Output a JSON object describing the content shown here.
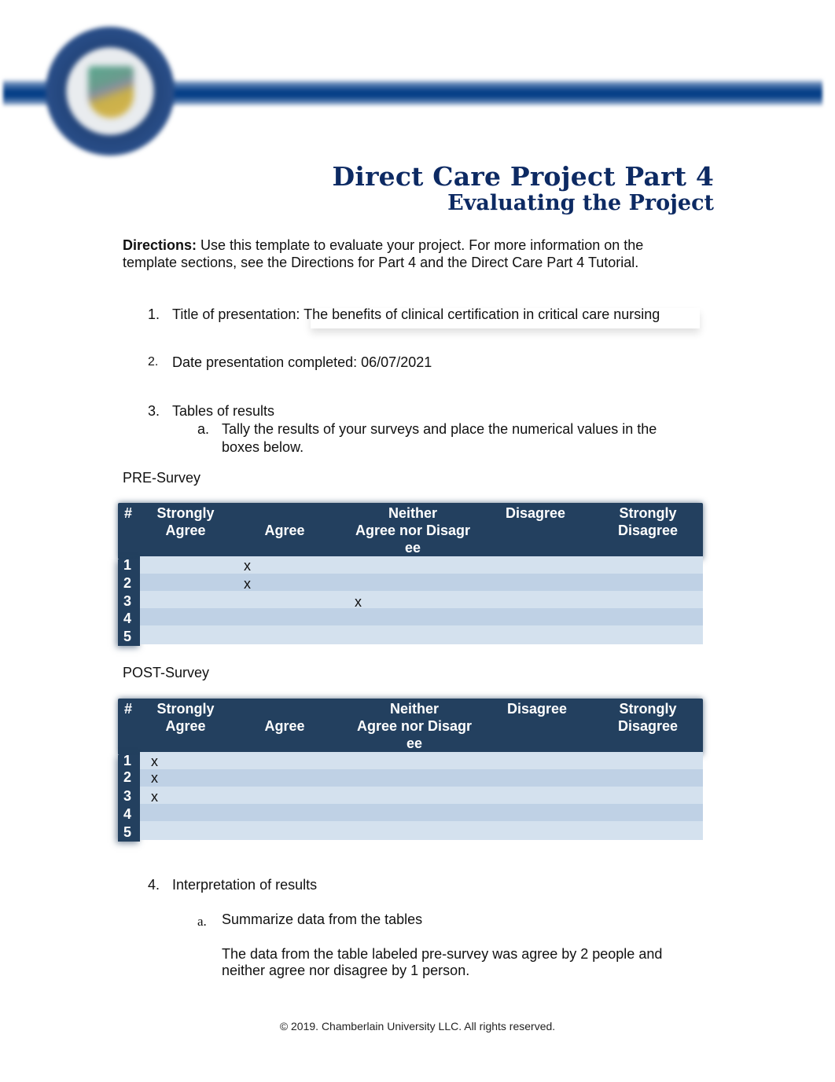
{
  "header": {
    "logo": "university-seal",
    "title": "Direct Care Project Part 4",
    "subtitle": "Evaluating the Project"
  },
  "directions": {
    "label": "Directions:",
    "line1": " Use this template to evaluate your project. For more information on the",
    "line2": "template sections, see the Directions for Part 4 and the Direct Care Part 4 Tutorial."
  },
  "items": {
    "item1": {
      "number": "1.",
      "text": "Title of presentation: The benefits of clinical certification in critical care nursing"
    },
    "item2": {
      "number": "2.",
      "text": "Date presentation completed: 06/07/2021"
    },
    "item3": {
      "number": "3.",
      "text": "Tables of results",
      "sub_a": {
        "letter": "a.",
        "line1": "Tally the results of your surveys and place the numerical values in the",
        "line2": "boxes below."
      }
    },
    "item4": {
      "number": "4.",
      "text": "Interpretation of results",
      "sub_a": {
        "letter": "a.",
        "text": "Summarize data from the tables",
        "answer_line1": "The data from the table labeled pre-survey was agree by 2 people and",
        "answer_line2": "neither agree nor disagree by 1 person."
      }
    }
  },
  "tables": {
    "columns": {
      "num": "#",
      "strongly_agree_1": "Strongly",
      "strongly_agree_2": "Agree",
      "agree": "Agree",
      "neither_1": "Neither",
      "neither_2": "Agree nor Disagr",
      "neither_3": "ee",
      "disagree": "Disagree",
      "strongly_disagree_1": "Strongly",
      "strongly_disagree_2": "Disagree"
    },
    "pre": {
      "label": "PRE-Survey",
      "rows": [
        {
          "n": "1",
          "strongly_agree": "",
          "agree": "x",
          "neither": "",
          "disagree": "",
          "strongly_disagree": ""
        },
        {
          "n": "2",
          "strongly_agree": "",
          "agree": "x",
          "neither": "",
          "disagree": "",
          "strongly_disagree": ""
        },
        {
          "n": "3",
          "strongly_agree": "",
          "agree": "",
          "neither": "x",
          "disagree": "",
          "strongly_disagree": ""
        },
        {
          "n": "4",
          "strongly_agree": "",
          "agree": "",
          "neither": "",
          "disagree": "",
          "strongly_disagree": ""
        },
        {
          "n": "5",
          "strongly_agree": "",
          "agree": "",
          "neither": "",
          "disagree": "",
          "strongly_disagree": ""
        }
      ]
    },
    "post": {
      "label": "POST-Survey",
      "rows": [
        {
          "n": "1",
          "strongly_agree": "x",
          "agree": "",
          "neither": "",
          "disagree": "",
          "strongly_disagree": ""
        },
        {
          "n": "2",
          "strongly_agree": "x",
          "agree": "",
          "neither": "",
          "disagree": "",
          "strongly_disagree": ""
        },
        {
          "n": "3",
          "strongly_agree": "x",
          "agree": "",
          "neither": "",
          "disagree": "",
          "strongly_disagree": ""
        },
        {
          "n": "4",
          "strongly_agree": "",
          "agree": "",
          "neither": "",
          "disagree": "",
          "strongly_disagree": ""
        },
        {
          "n": "5",
          "strongly_agree": "",
          "agree": "",
          "neither": "",
          "disagree": "",
          "strongly_disagree": ""
        }
      ]
    }
  },
  "footer": {
    "copyright": "© 2019. Chamberlain University LLC. All rights reserved."
  },
  "colors": {
    "brand_navy": "#0d2a63",
    "banner_blue": "#063f87",
    "table_header": "#23405f",
    "row_light": "#d4e1ee",
    "row_dark": "#bfd1e5"
  }
}
